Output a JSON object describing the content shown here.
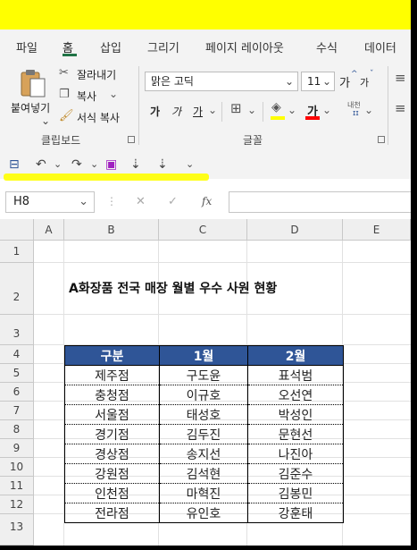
{
  "ribbon_tabs": [
    "파일",
    "홈",
    "삽입",
    "그리기",
    "페이지 레이아웃",
    "수식",
    "데이터"
  ],
  "clipboard": {
    "paste_label": "붙여넣기",
    "cut_label": "잘라내기",
    "copy_label": "복사",
    "format_painter_label": "서식 복사",
    "group_label": "클립보드"
  },
  "font": {
    "font_name": "맑은 고딕",
    "font_size": "11",
    "group_label": "글꼴",
    "grow_glyph": "가",
    "shrink_glyph": "가",
    "bold_glyph": "가",
    "italic_glyph": "가",
    "underline_glyph": "가",
    "fill_glyph": "가",
    "font_color_glyph": "가",
    "phonetic_label": "내천"
  },
  "formula_bar": {
    "name_box": "H8",
    "fx": "fx",
    "cancel": "✕",
    "enter": "✓",
    "value": ""
  },
  "columns": [
    "A",
    "B",
    "C",
    "D",
    "E"
  ],
  "rows": [
    "1",
    "2",
    "3",
    "4",
    "5",
    "6",
    "7",
    "8",
    "9",
    "10",
    "11",
    "12",
    "13"
  ],
  "sheet": {
    "title": "A화장품 전국 매장 월별 우수 사원 현황",
    "headers": [
      "구분",
      "1월",
      "2월"
    ],
    "data": [
      [
        "제주점",
        "구도윤",
        "표석범"
      ],
      [
        "충청점",
        "이규호",
        "오선연"
      ],
      [
        "서울점",
        "태성호",
        "박성인"
      ],
      [
        "경기점",
        "김두진",
        "문현선"
      ],
      [
        "경상점",
        "송지선",
        "나진아"
      ],
      [
        "강원점",
        "김석현",
        "김준수"
      ],
      [
        "인천점",
        "마혁진",
        "김봉민"
      ],
      [
        "전라점",
        "유인호",
        "강훈태"
      ]
    ],
    "header_color": "#2f5597"
  },
  "accent_color": "#217346",
  "annotation_color": "#ffff00"
}
